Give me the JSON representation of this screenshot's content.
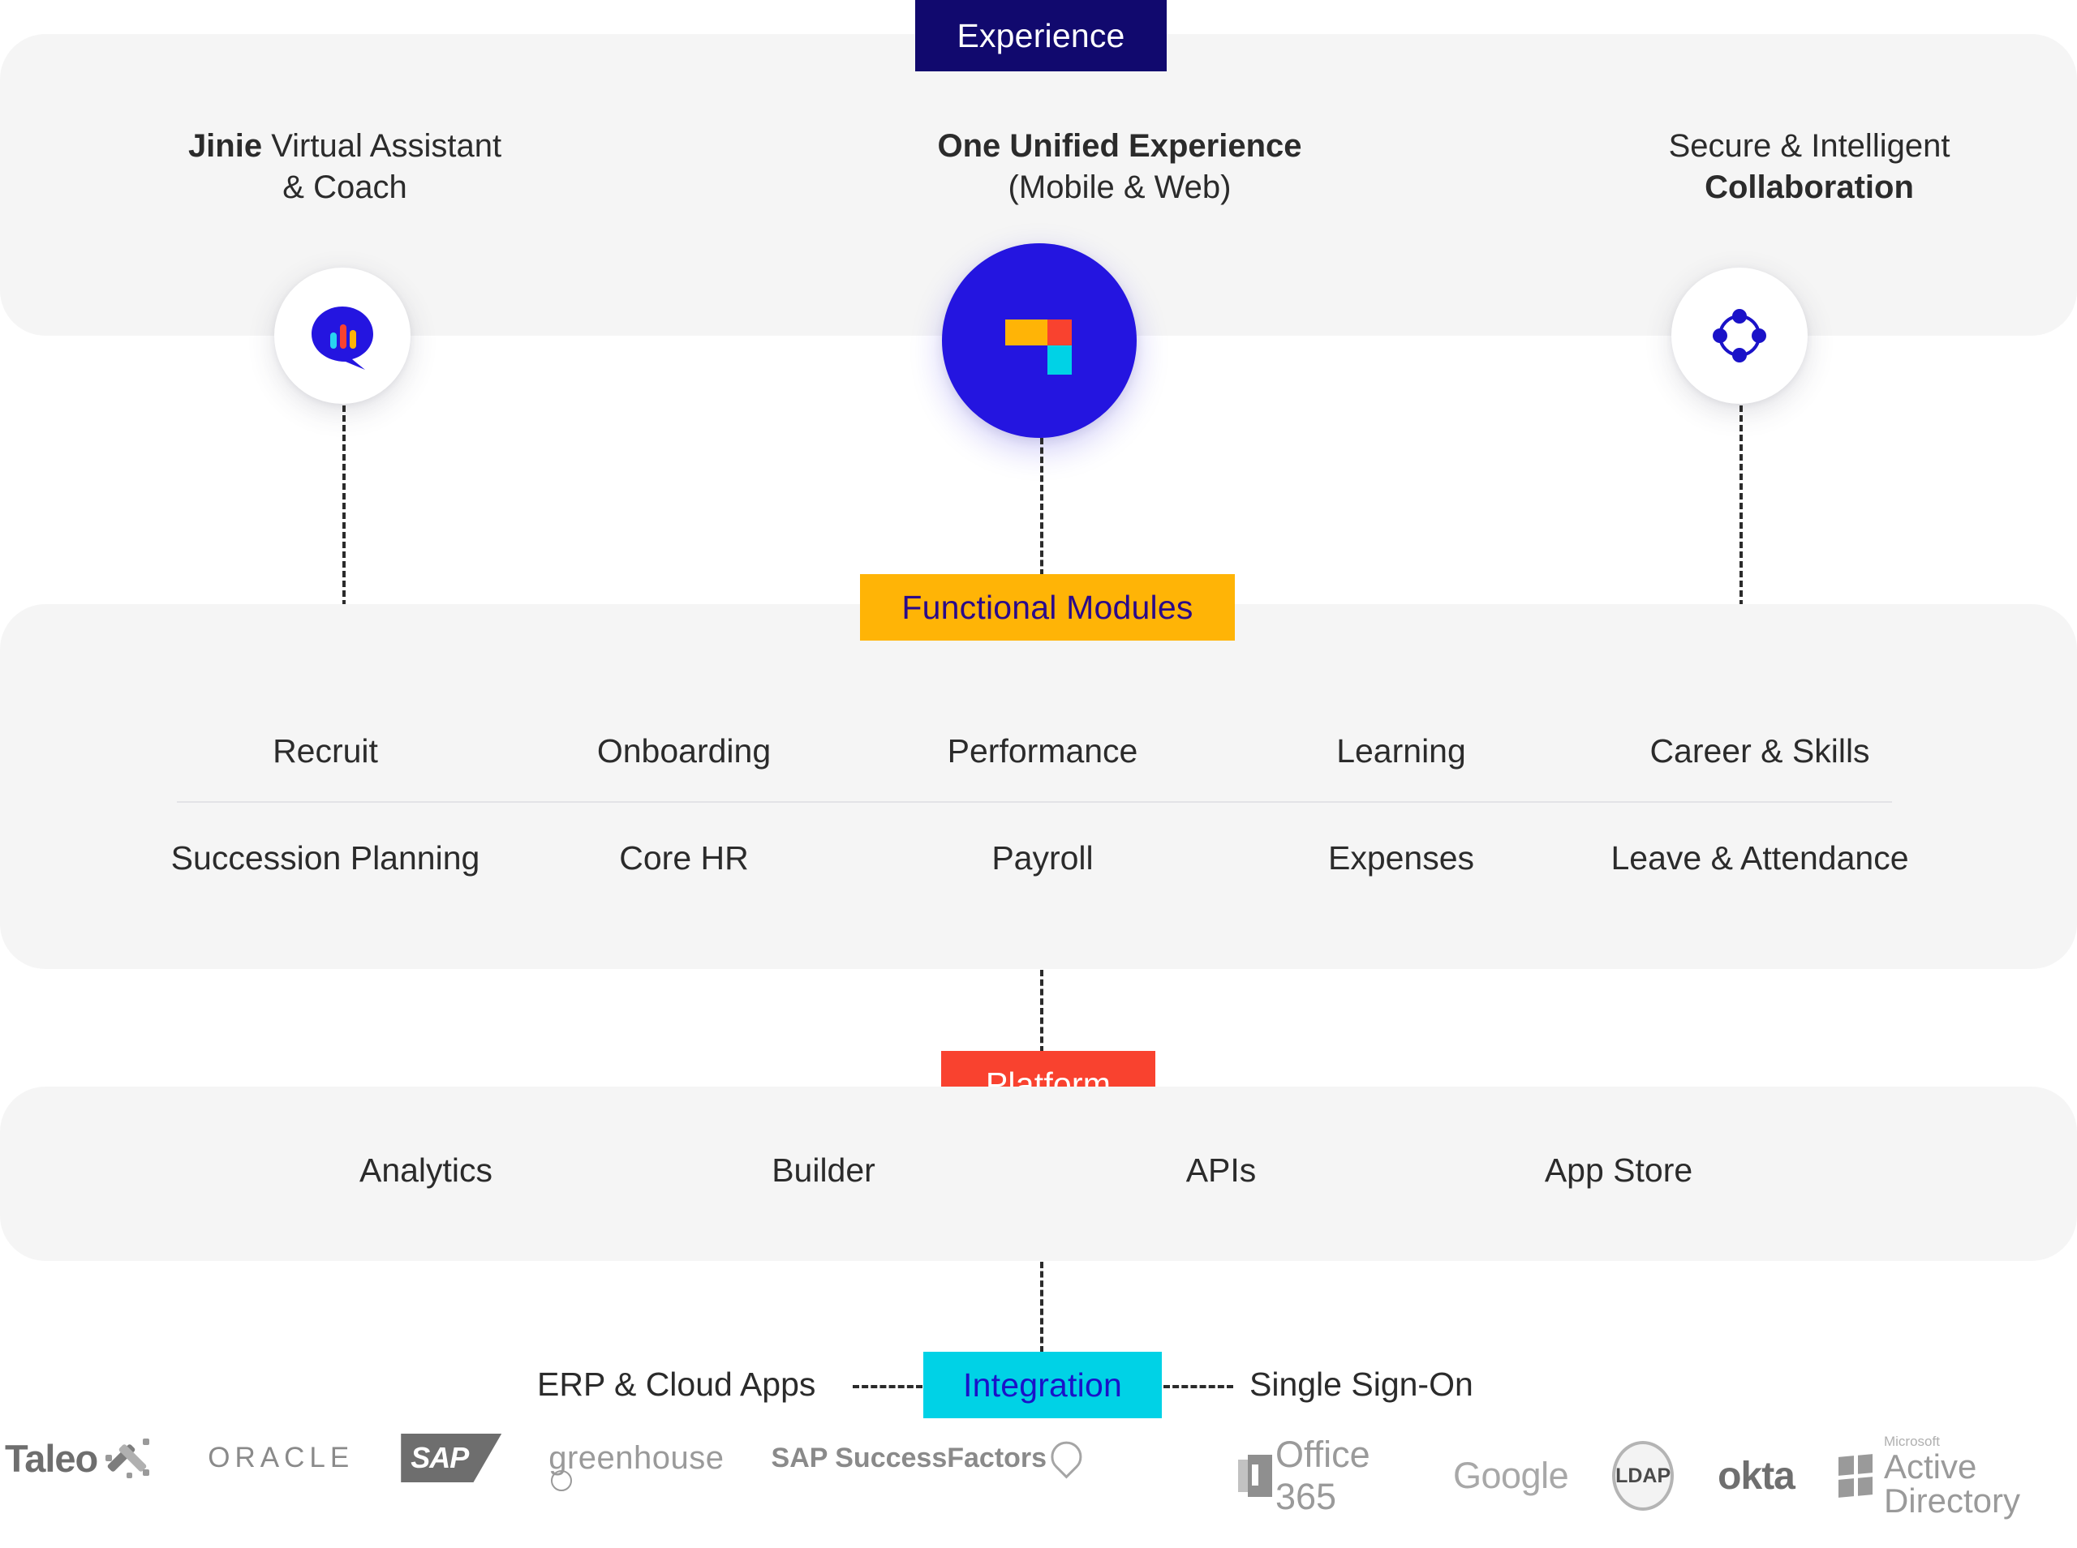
{
  "sections": {
    "experience_chip": "Experience",
    "functional_chip": "Functional Modules",
    "platform_chip": "Platform",
    "integration_chip": "Integration"
  },
  "experience": {
    "columns": [
      {
        "title_bold": "Jinie",
        "title_rest": " Virtual Assistant",
        "subtitle": "& Coach",
        "icon": "chat-bubble-waveform-icon"
      },
      {
        "title_bold": "One Unified Experience",
        "title_rest": "",
        "subtitle": "(Mobile & Web)",
        "icon": "darwinbox-logo-icon"
      },
      {
        "title_bold": "",
        "title_rest": "Secure & Intelligent",
        "subtitle": "Collaboration",
        "icon": "network-nodes-icon"
      }
    ]
  },
  "modules": {
    "row1": [
      "Recruit",
      "Onboarding",
      "Performance",
      "Learning",
      "Career & Skills"
    ],
    "row2": [
      "Succession Planning",
      "Core HR",
      "Payroll",
      "Expenses",
      "Leave & Attendance"
    ]
  },
  "platform": {
    "items": [
      "Analytics",
      "Builder",
      "APIs",
      "App Store"
    ]
  },
  "integration": {
    "left_label": "ERP & Cloud Apps",
    "right_label": "Single Sign-On"
  },
  "partner_logos": {
    "left": [
      {
        "name": "Taleo",
        "text": "Taleo"
      },
      {
        "name": "Oracle",
        "text": "ORACLE"
      },
      {
        "name": "SAP",
        "text": "SAP"
      },
      {
        "name": "greenhouse",
        "text": "greenhouse"
      },
      {
        "name": "SAP SuccessFactors",
        "text": "SAP SuccessFactors"
      }
    ],
    "right": [
      {
        "name": "Office 365",
        "text": "Office 365"
      },
      {
        "name": "Google",
        "text": "Google"
      },
      {
        "name": "LDAP",
        "text": "LDAP"
      },
      {
        "name": "okta",
        "text": "okta"
      },
      {
        "name": "Microsoft Active Directory",
        "text_small": "Microsoft",
        "text": "Active Directory"
      }
    ]
  },
  "colors": {
    "navy": "#11096e",
    "amber": "#ffb406",
    "red": "#f9422f",
    "cyan": "#00d2e6",
    "brand_blue": "#2415e0",
    "panel_bg": "#f5f5f5",
    "text": "#2b2b2b"
  }
}
